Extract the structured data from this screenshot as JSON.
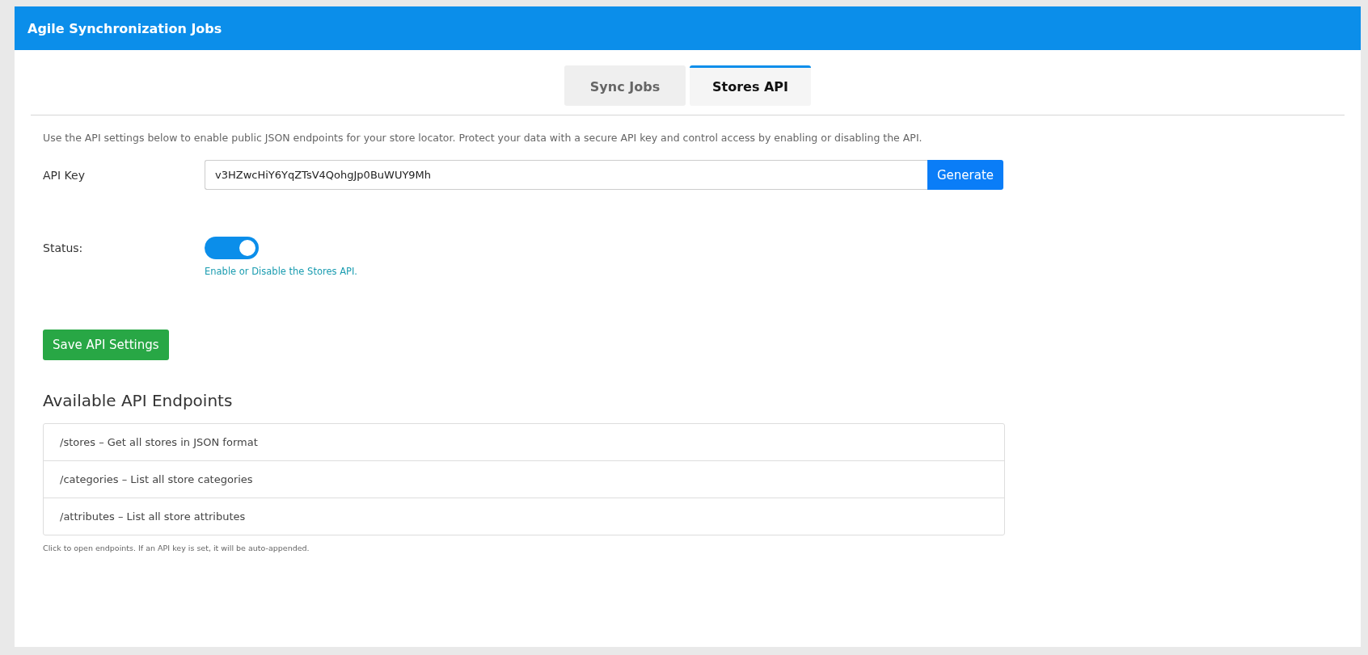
{
  "header": {
    "title": "Agile Synchronization Jobs"
  },
  "tabs": [
    {
      "label": "Sync Jobs",
      "selected": false
    },
    {
      "label": "Stores API",
      "selected": true
    }
  ],
  "description": "Use the API settings below to enable public JSON endpoints for your store locator. Protect your data with a secure API key and control access by enabling or disabling the API.",
  "api_key": {
    "label": "API Key",
    "value": "v3HZwcHiY6YqZTsV4QohgJp0BuWUY9Mh",
    "button": "Generate"
  },
  "status": {
    "label": "Status:",
    "on": true,
    "help": "Enable or Disable the Stores API."
  },
  "save_button": "Save API Settings",
  "endpoints": {
    "title": "Available API Endpoints",
    "items": [
      "/stores – Get all stores in JSON format",
      "/categories – List all store categories",
      "/attributes – List all store attributes"
    ],
    "note": "Click to open endpoints. If an API key is set, it will be auto-appended."
  }
}
